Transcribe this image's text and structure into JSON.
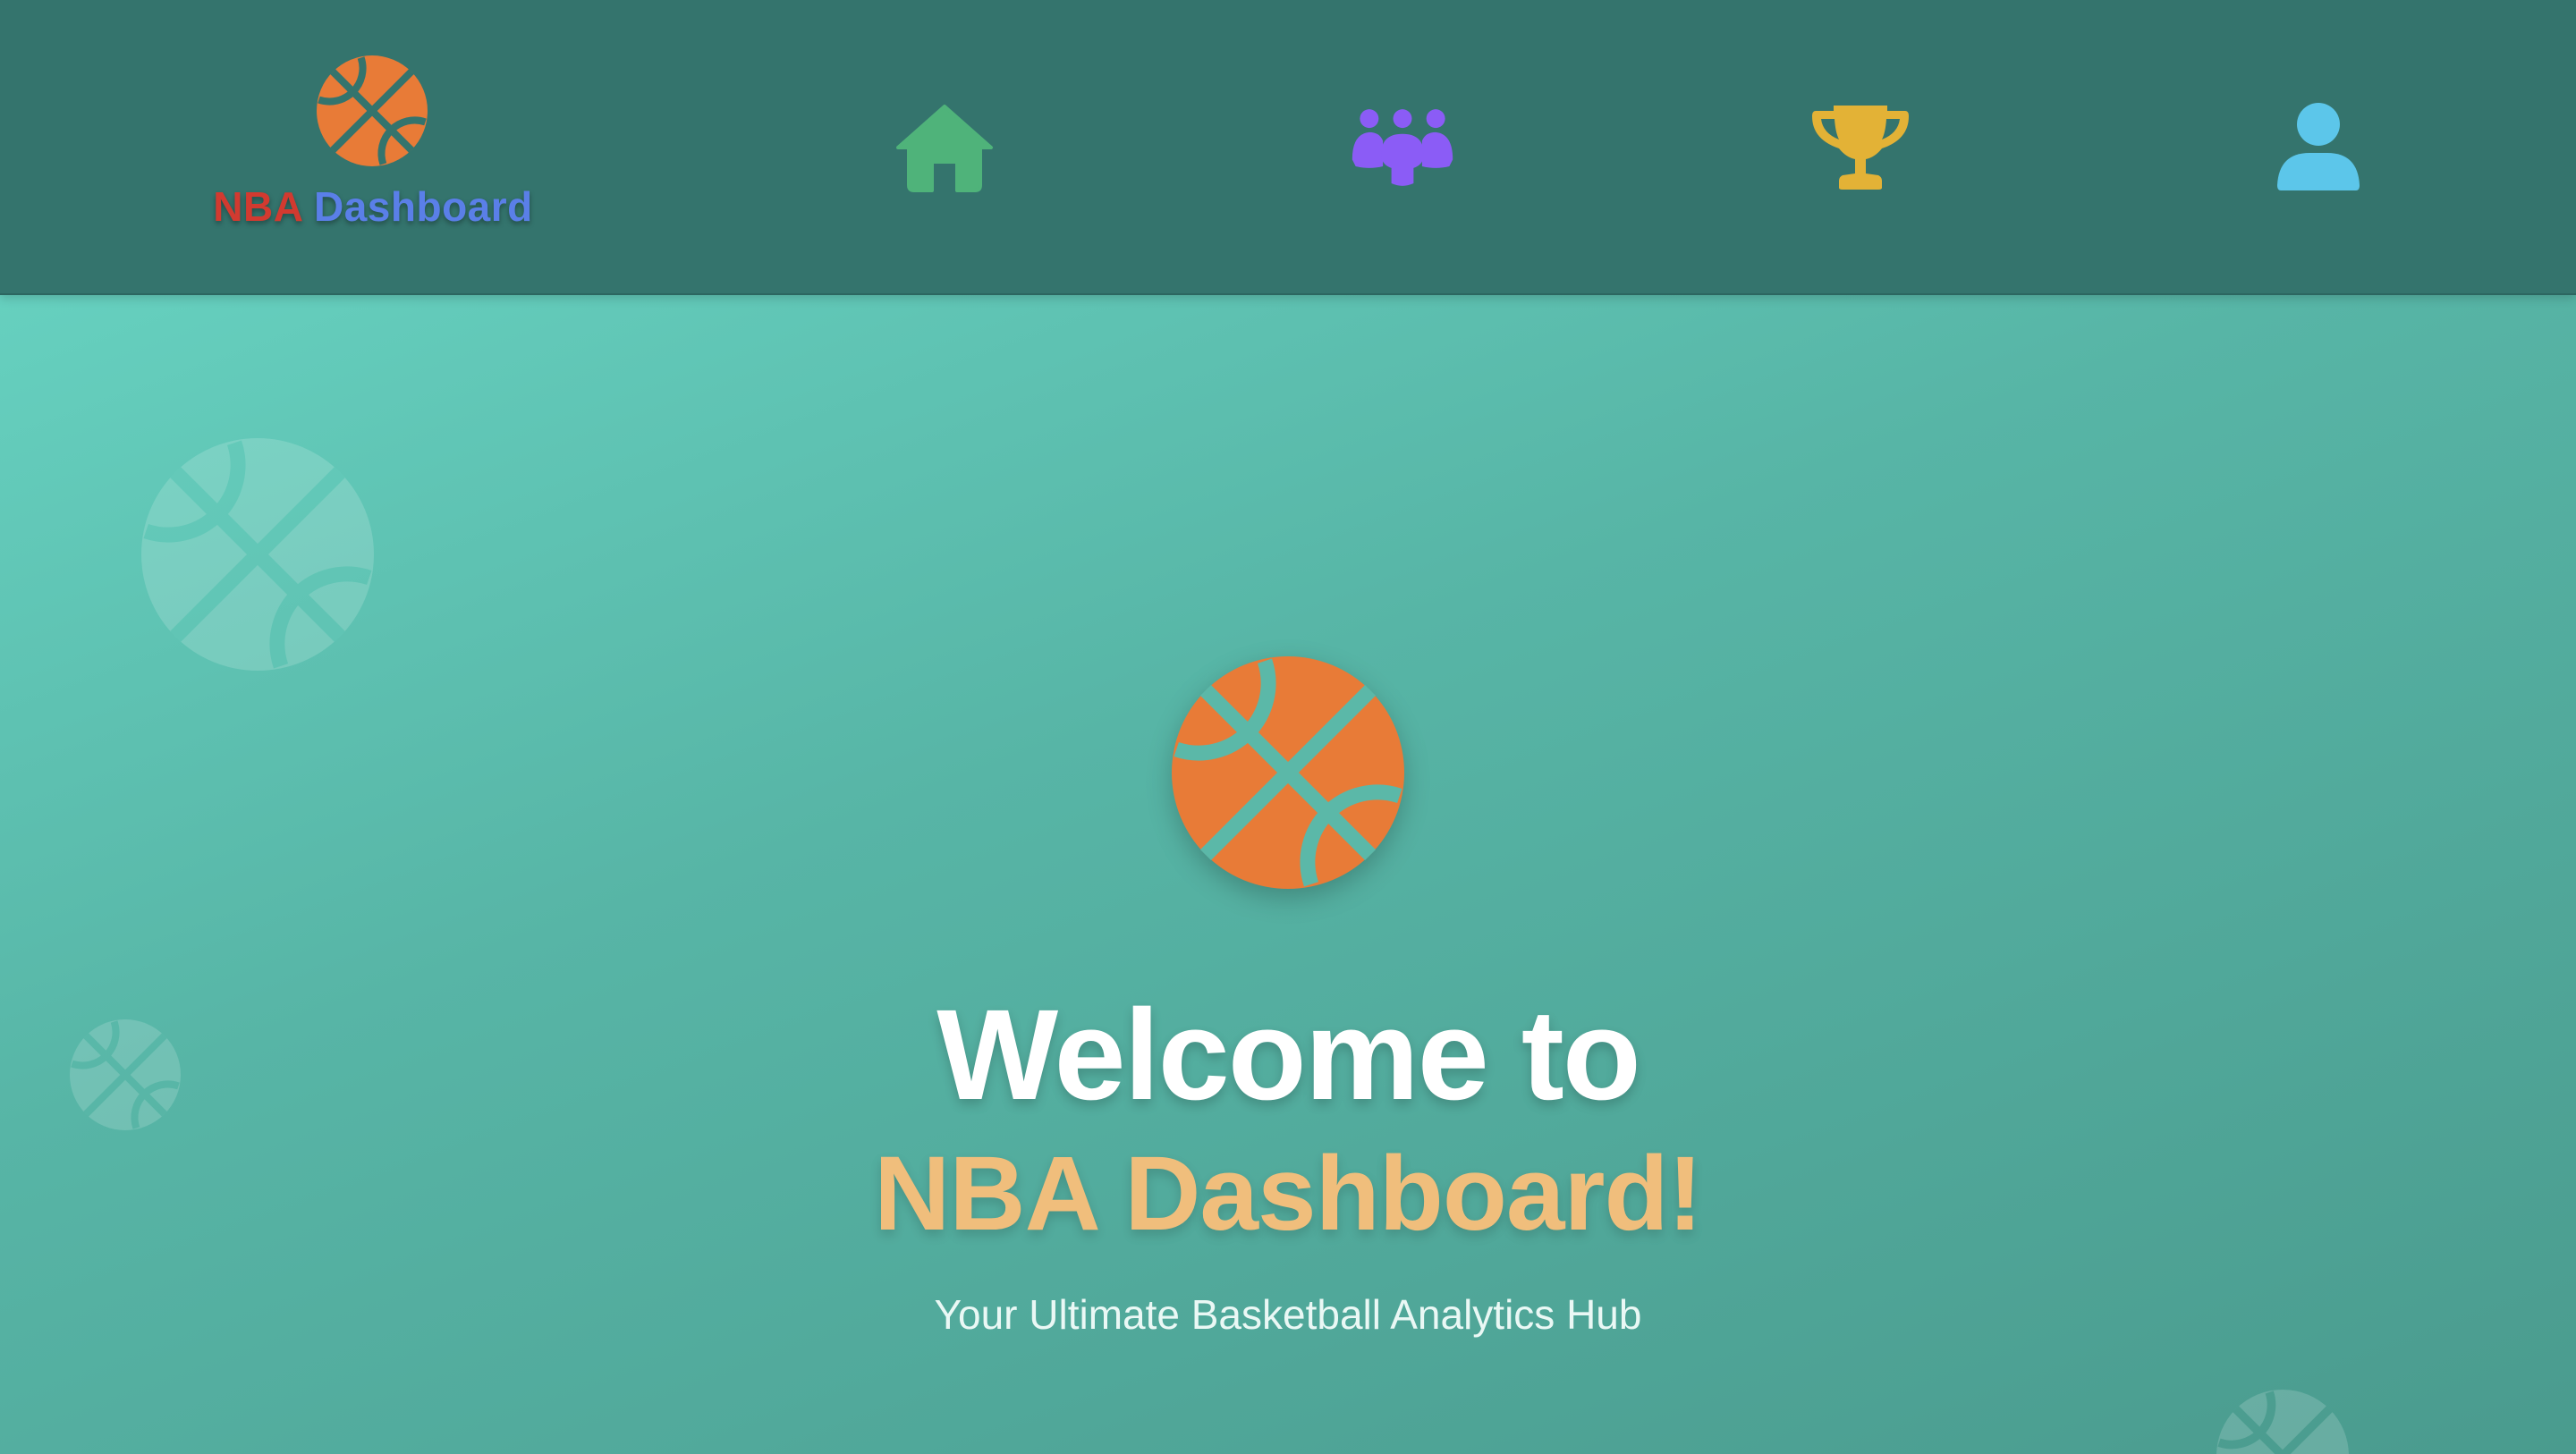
{
  "header": {
    "logo": {
      "icon": "basketball-icon",
      "brand_part1": "NBA",
      "brand_part2": "Dashboard",
      "brand_color_part1": "#d23a30",
      "brand_color_part2": "#5a7fe8"
    },
    "nav": [
      {
        "icon": "home-icon",
        "color": "#4fb37a"
      },
      {
        "icon": "users-group-icon",
        "color": "#8b5cf6"
      },
      {
        "icon": "trophy-icon",
        "color": "#e3b236"
      },
      {
        "icon": "user-icon",
        "color": "#5cc6ea"
      }
    ],
    "background": "#34746d"
  },
  "hero": {
    "icon": "basketball-icon",
    "title": "Welcome to",
    "subtitle": "NBA Dashboard!",
    "tagline": "Your Ultimate Basketball Analytics Hub",
    "accent_color": "#f0be7c",
    "ball_color": "#e87b37"
  }
}
